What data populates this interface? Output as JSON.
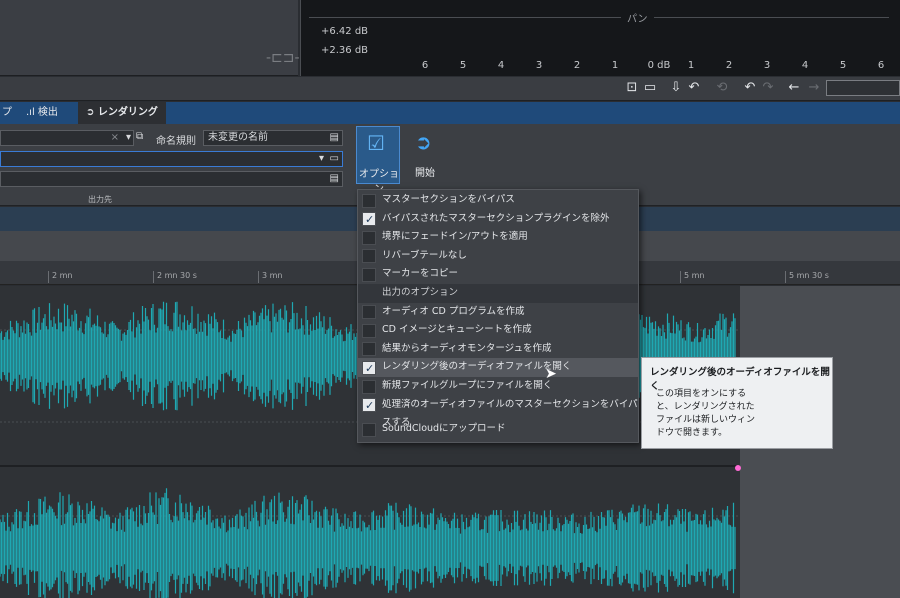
{
  "meter": {
    "pan_label": "パン",
    "db_values": [
      "+6.42 dB",
      "+2.36 dB"
    ],
    "scale": [
      "6",
      "5",
      "4",
      "3",
      "2",
      "1",
      "0 dB",
      "1",
      "2",
      "3",
      "4",
      "5",
      "6"
    ]
  },
  "tabs": {
    "items": [
      {
        "label": "プ"
      },
      {
        "label": "検出",
        "icon": "bar-chart-icon"
      },
      {
        "label": "レンダリング",
        "icon": "render-icon",
        "active": true
      }
    ]
  },
  "ribbon": {
    "naming_rule_label": "命名規則",
    "naming_rule_value": "未変更の名前",
    "output_section_label": "出力先",
    "options_label": "オプション",
    "start_label": "開始"
  },
  "ruler": {
    "marks": [
      "2 mn",
      "2 mn 30 s",
      "3 mn",
      "5 mn",
      "5 mn 30 s"
    ]
  },
  "menu": {
    "items": [
      {
        "label": "マスターセクションをバイパス",
        "checked": false
      },
      {
        "label": "バイパスされたマスターセクションプラグインを除外",
        "checked": true
      },
      {
        "label": "境界にフェードイン/アウトを適用",
        "checked": false
      },
      {
        "label": "リバーブテールなし",
        "checked": false
      },
      {
        "label": "マーカーをコピー",
        "checked": false
      },
      {
        "label": "出力のオプション",
        "header": true
      },
      {
        "label": "オーディオ CD プログラムを作成",
        "checked": false
      },
      {
        "label": "CD イメージとキューシートを作成",
        "checked": false
      },
      {
        "label": "結果からオーディオモンタージュを作成",
        "checked": false
      },
      {
        "label": "レンダリング後のオーディオファイルを開く",
        "checked": true,
        "highlighted": true
      },
      {
        "label": "新規ファイルグループにファイルを開く",
        "checked": false
      },
      {
        "label": "処理済のオーディオファイルのマスターセクションをバイパスする",
        "checked": true
      },
      {
        "label": "SoundCloudにアップロード",
        "checked": false
      }
    ]
  },
  "tooltip": {
    "title": "レンダリング後のオーディオファイルを開く",
    "body": "この項目をオンにすると、レンダリングされたファイルは新しいウィンドウで開きます。"
  },
  "colors": {
    "waveform": "#1fa8b2",
    "tab_bar": "#1f4a7a",
    "accent": "#3a7bd5"
  }
}
